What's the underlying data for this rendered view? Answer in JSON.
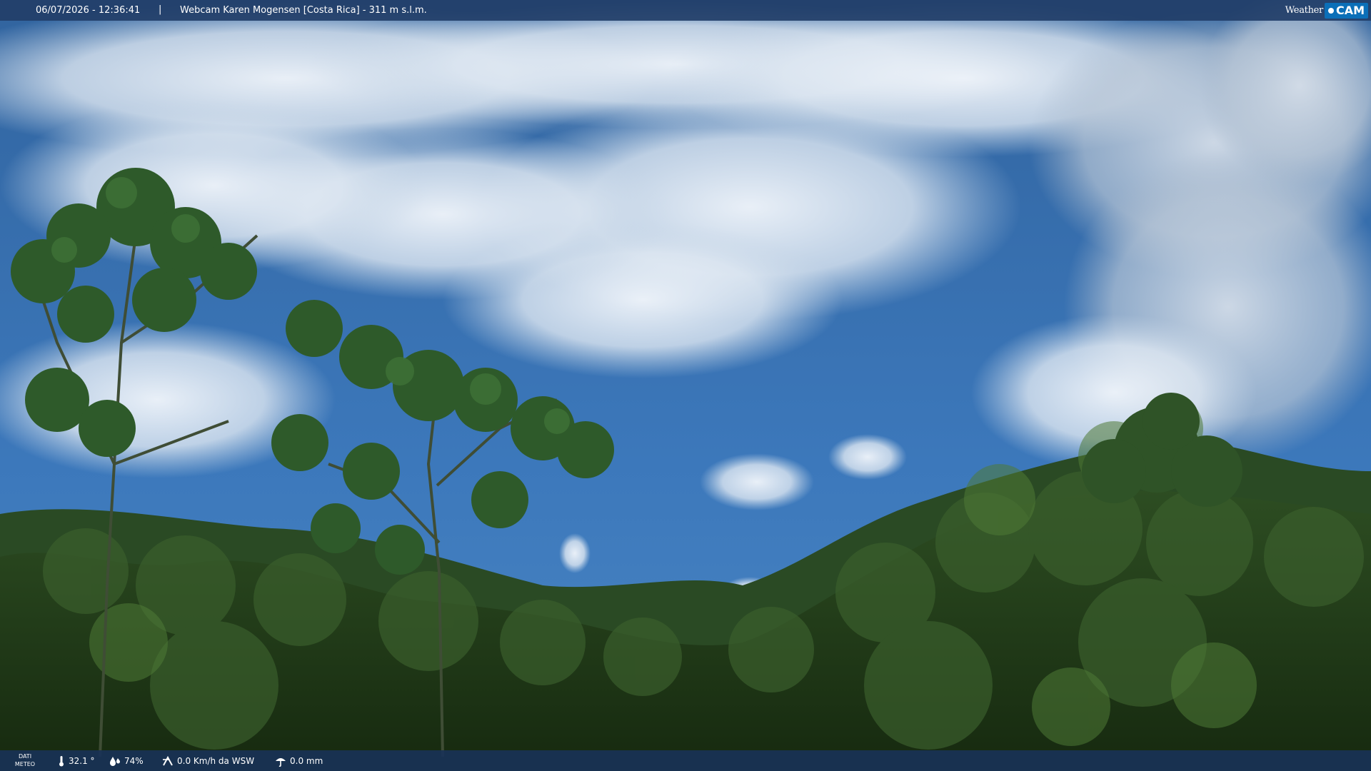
{
  "top_bar": {
    "datetime": "06/07/2026 - 12:36:41",
    "separator": "|",
    "title": "Webcam Karen Mogensen [Costa Rica] - 311 m s.l.m."
  },
  "logo": {
    "weather": "Weather",
    "cam": "CAM"
  },
  "bottom_bar": {
    "dati_line1": "DATI",
    "dati_line2": "METEO",
    "temperature": "32.1 °",
    "humidity": "74%",
    "wind": "0.0 Km/h da WSW",
    "rain": "0.0 mm",
    "icons": [
      "thermometer-icon",
      "humidity-drop-icon",
      "wind-icon",
      "rain-icon"
    ]
  },
  "colors": {
    "sky": "#3a73b7",
    "cloud": "#e6eef7",
    "forest": "#1f3b1a",
    "bar": "#1e3b66",
    "logo_accent": "#0b6fb8"
  }
}
